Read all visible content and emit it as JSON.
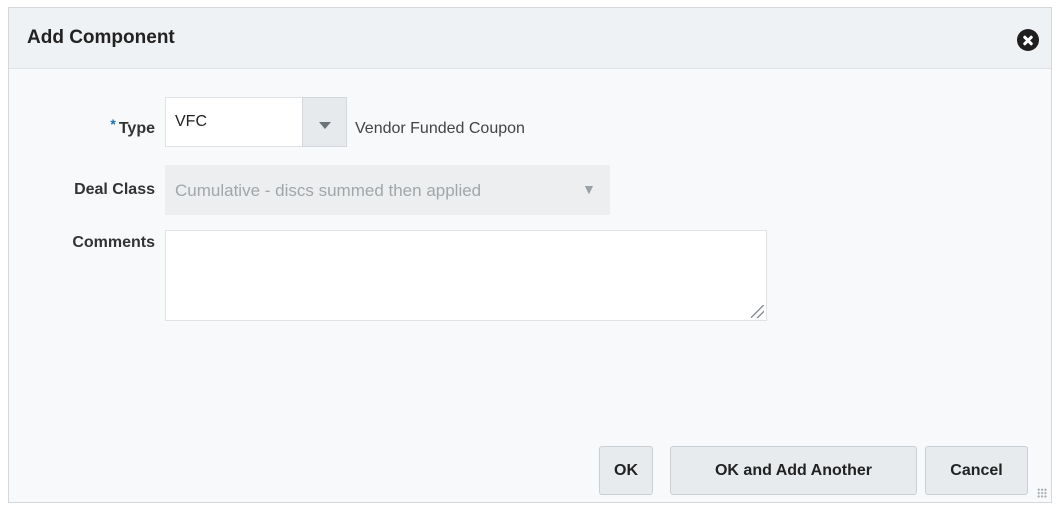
{
  "dialog": {
    "title": "Add Component"
  },
  "form": {
    "type": {
      "required_marker": "*",
      "label": "Type",
      "value": "VFC",
      "description": "Vendor Funded Coupon"
    },
    "deal_class": {
      "label": "Deal Class",
      "value": "Cumulative - discs summed then applied",
      "arrow": "▼"
    },
    "comments": {
      "label": "Comments",
      "value": ""
    }
  },
  "buttons": {
    "ok": "OK",
    "ok_add_another": "OK and Add Another",
    "cancel": "Cancel"
  },
  "icons": {
    "close": "close-icon",
    "dropdown": "chevron-down-icon",
    "resize": "resize-grip-icon"
  }
}
